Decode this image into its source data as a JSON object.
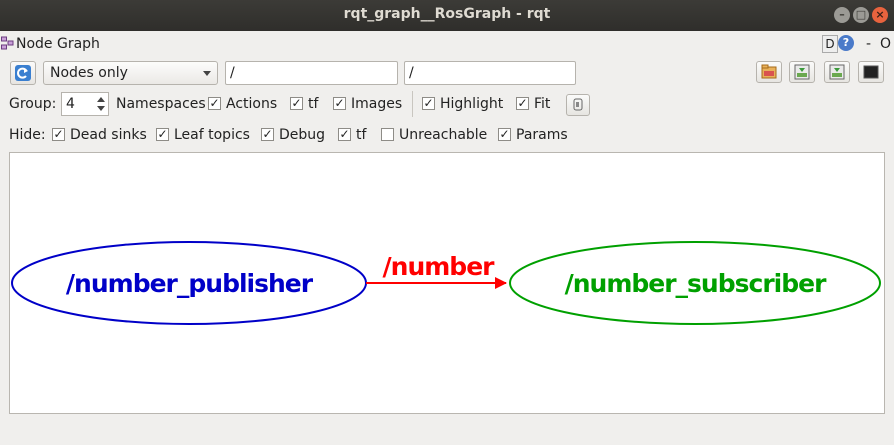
{
  "window": {
    "title": "rqt_graph__RosGraph - rqt"
  },
  "plugin": {
    "title": "Node Graph",
    "right_d": "D",
    "right_q": "?",
    "right_dash": "-",
    "right_o": "O"
  },
  "toolbar": {
    "mode_selected": "Nodes only",
    "filter1_value": "/",
    "filter2_value": "/"
  },
  "options": {
    "group_label": "Group:",
    "group_value": "4",
    "namespaces_label": "Namespaces",
    "actions_label": "Actions",
    "tf_label": "tf",
    "images_label": "Images",
    "highlight_label": "Highlight",
    "fit_label": "Fit"
  },
  "hide": {
    "label": "Hide:",
    "dead_sinks": "Dead sinks",
    "leaf_topics": "Leaf topics",
    "debug": "Debug",
    "tf": "tf",
    "unreachable": "Unreachable",
    "params": "Params"
  },
  "checks": {
    "namespaces": true,
    "actions": true,
    "tf": true,
    "images": true,
    "highlight": true,
    "fit": true,
    "dead_sinks": true,
    "leaf_topics": true,
    "debug": true,
    "hide_tf": true,
    "unreachable": false,
    "params": true
  },
  "graph": {
    "publisher_node": "/number_publisher",
    "topic": "/number",
    "subscriber_node": "/number_subscriber",
    "publisher_color": "#0000c8",
    "topic_color": "#ff0000",
    "subscriber_color": "#00a000"
  }
}
